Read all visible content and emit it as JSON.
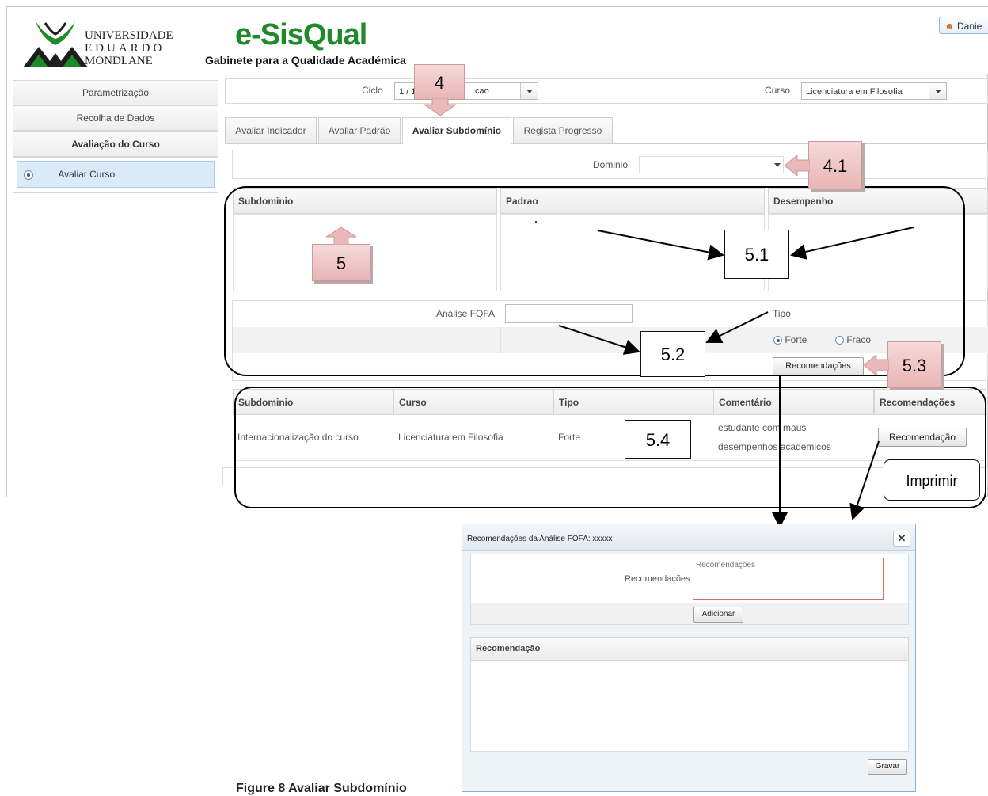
{
  "header": {
    "university": [
      "UNIVERSIDADE",
      "EDUARDO",
      "MONDLANE"
    ],
    "brand": "e-SisQual",
    "brand_sub": "Gabinete para a Qualidade Académica",
    "user": "Danie",
    "logo_colors": {
      "green": "#1f8a2a",
      "dark": "#1e1e1e"
    }
  },
  "menu": {
    "items": [
      "Parametrização",
      "Recolha de Dados",
      "Avaliação do Curso"
    ],
    "sub_item": "Avaliar Curso"
  },
  "filters": {
    "ciclo_label": "Ciclo",
    "ciclo_value": "1 / 1",
    "ciclo_value_tail": "cao",
    "curso_label": "Curso",
    "curso_value": "Licenciatura em Filosofia"
  },
  "tabs": [
    "Avaliar Indicador",
    "Avaliar Padrão",
    "Avaliar Subdomínio",
    "Regista Progresso"
  ],
  "dominio_label": "Dominio",
  "grid1": {
    "headers": [
      "Subdominio",
      "Padrao",
      "Desempenho"
    ]
  },
  "fofa": {
    "label": "Análise FOFA",
    "tipo_label": "Tipo",
    "options": [
      "Forte",
      "Fraco"
    ],
    "selected": "Forte",
    "button": "Recomendações"
  },
  "grid2": {
    "headers": [
      "Subdominio",
      "Curso",
      "Tipo",
      "Comentário",
      "Recomendações"
    ],
    "rows": [
      {
        "subdominio": "Internacionalização do curso",
        "curso": "Licenciatura em Filosofia",
        "tipo": "Forte",
        "comentario": [
          "estudante com maus",
          "desempenhos academicos"
        ],
        "button": "Recomendação"
      }
    ]
  },
  "annotations": {
    "a4": "4",
    "a41": "4.1",
    "a5": "5",
    "a51": "5.1",
    "a52": "5.2",
    "a53": "5.3",
    "a54": "5.4",
    "imprimir": "Imprimir"
  },
  "dialog": {
    "title": "Recomendações da Análise FOFA: xxxxx",
    "field_label": "Recomendações",
    "placeholder": "Recomendações",
    "add_button": "Adicionar",
    "grid_header": "Recomendação",
    "save_button": "Gravar"
  },
  "caption": "Figure 8 Avaliar Subdomínio"
}
